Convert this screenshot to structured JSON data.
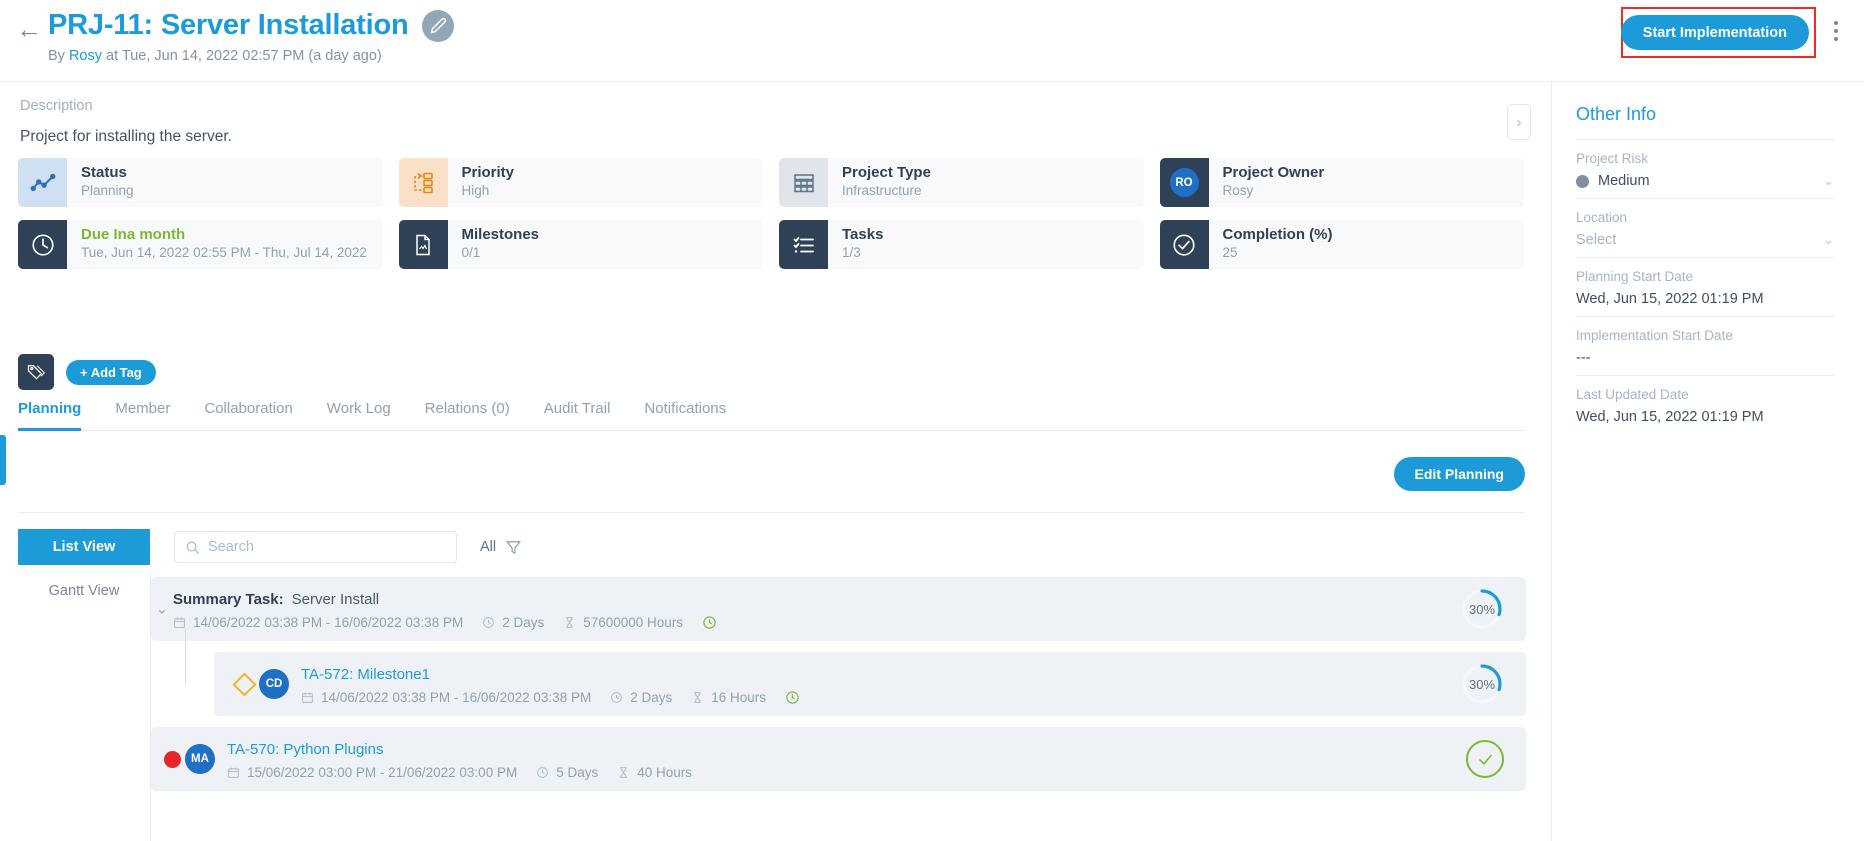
{
  "header": {
    "back_icon": "arrow-left-icon",
    "title": "PRJ-11: Server Installation",
    "edit_icon": "pencil-icon",
    "byline_prefix": "By",
    "byline_author": "Rosy",
    "byline_suffix": "at Tue, Jun 14, 2022 02:57 PM (a day ago)",
    "start_button": "Start Implementation",
    "menu_icon": "kebab-menu-icon",
    "highlight_color": "#ec2a26",
    "accent_color": "#1d9bd9"
  },
  "description": {
    "label": "Description",
    "text": "Project for installing the server.",
    "collapse_icon": "chevron-right-icon"
  },
  "cards": [
    {
      "key": "Status",
      "value": "Planning",
      "icon": "chart-line-icon",
      "icon_style": "ico-blue"
    },
    {
      "key": "Priority",
      "value": "High",
      "icon": "priority-flow-icon",
      "icon_style": "ico-orange"
    },
    {
      "key": "Project Type",
      "value": "Infrastructure",
      "icon": "layers-grid-icon",
      "icon_style": "ico-grey"
    },
    {
      "key": "Project Owner",
      "value": "Rosy",
      "icon": "avatar-initials",
      "icon_style": "ico-dark",
      "initials": "RO"
    },
    {
      "key": "Due Ina month",
      "value": "Tue, Jun 14, 2022 02:55 PM - Thu, Jul 14, 2022",
      "icon": "clock-icon",
      "icon_style": "ico-dark",
      "key_green": true
    },
    {
      "key": "Milestones",
      "value": "0/1",
      "icon": "milestone-doc-icon",
      "icon_style": "ico-dark"
    },
    {
      "key": "Tasks",
      "value": "1/3",
      "icon": "checklist-icon",
      "icon_style": "ico-dark"
    },
    {
      "key": "Completion (%)",
      "value": "25",
      "icon": "check-circle-icon",
      "icon_style": "ico-dark"
    }
  ],
  "tags": {
    "icon": "tag-icon",
    "add_label": "+ Add Tag"
  },
  "tabs": [
    {
      "label": "Planning",
      "active": true
    },
    {
      "label": "Member",
      "active": false
    },
    {
      "label": "Collaboration",
      "active": false
    },
    {
      "label": "Work Log",
      "active": false
    },
    {
      "label": "Relations (0)",
      "active": false
    },
    {
      "label": "Audit Trail",
      "active": false
    },
    {
      "label": "Notifications",
      "active": false
    }
  ],
  "planning": {
    "edit_button": "Edit Planning",
    "list_view_button": "List View",
    "gantt_view_button": "Gantt View",
    "search_placeholder": "Search",
    "search_value": "",
    "search_icon": "search-icon",
    "filter_label": "All",
    "filter_icon": "funnel-icon"
  },
  "tasks": [
    {
      "type": "summary",
      "label": "Summary Task:",
      "name": "Server Install",
      "dates": "14/06/2022 03:38 PM - 16/06/2022 03:38 PM",
      "days": "2 Days",
      "hours": "57600000 Hours",
      "progress": "30%",
      "progress_value": 30,
      "has_clock": true,
      "calendar_icon": "calendar-icon",
      "clock_icon": "clock-icon",
      "hourglass_icon": "hourglass-icon",
      "chevron_icon": "chevron-down-icon"
    },
    {
      "type": "milestone",
      "name": "TA-572: Milestone1",
      "dates": "14/06/2022 03:38 PM - 16/06/2022 03:38 PM",
      "days": "2 Days",
      "hours": "16 Hours",
      "progress": "30%",
      "progress_value": 30,
      "has_clock": true,
      "avatar": "CD",
      "marker_icon": "diamond-milestone-icon",
      "calendar_icon": "calendar-icon",
      "clock_icon": "clock-icon",
      "hourglass_icon": "hourglass-icon"
    },
    {
      "type": "task",
      "name": "TA-570: Python Plugins",
      "dates": "15/06/2022 03:00 PM - 21/06/2022 03:00 PM",
      "days": "5 Days",
      "hours": "40 Hours",
      "progress": "",
      "done": true,
      "has_clock": false,
      "avatar": "MA",
      "marker_icon": "red-dot-icon",
      "calendar_icon": "calendar-icon",
      "clock_icon": "clock-icon",
      "hourglass_icon": "hourglass-icon"
    }
  ],
  "other_info": {
    "title": "Other Info",
    "fields": [
      {
        "label": "Project Risk",
        "value": "Medium",
        "dot": "#7f8fa0",
        "chevron": true,
        "muted": false
      },
      {
        "label": "Location",
        "value": "Select",
        "dot": null,
        "chevron": true,
        "muted": true
      },
      {
        "label": "Planning Start Date",
        "value": "Wed, Jun 15, 2022 01:19 PM",
        "dot": null,
        "chevron": false,
        "muted": false
      },
      {
        "label": "Implementation Start Date",
        "value": "---",
        "dot": null,
        "chevron": false,
        "muted": false
      },
      {
        "label": "Last Updated Date",
        "value": "Wed, Jun 15, 2022 01:19 PM",
        "dot": null,
        "chevron": false,
        "muted": false
      }
    ]
  }
}
